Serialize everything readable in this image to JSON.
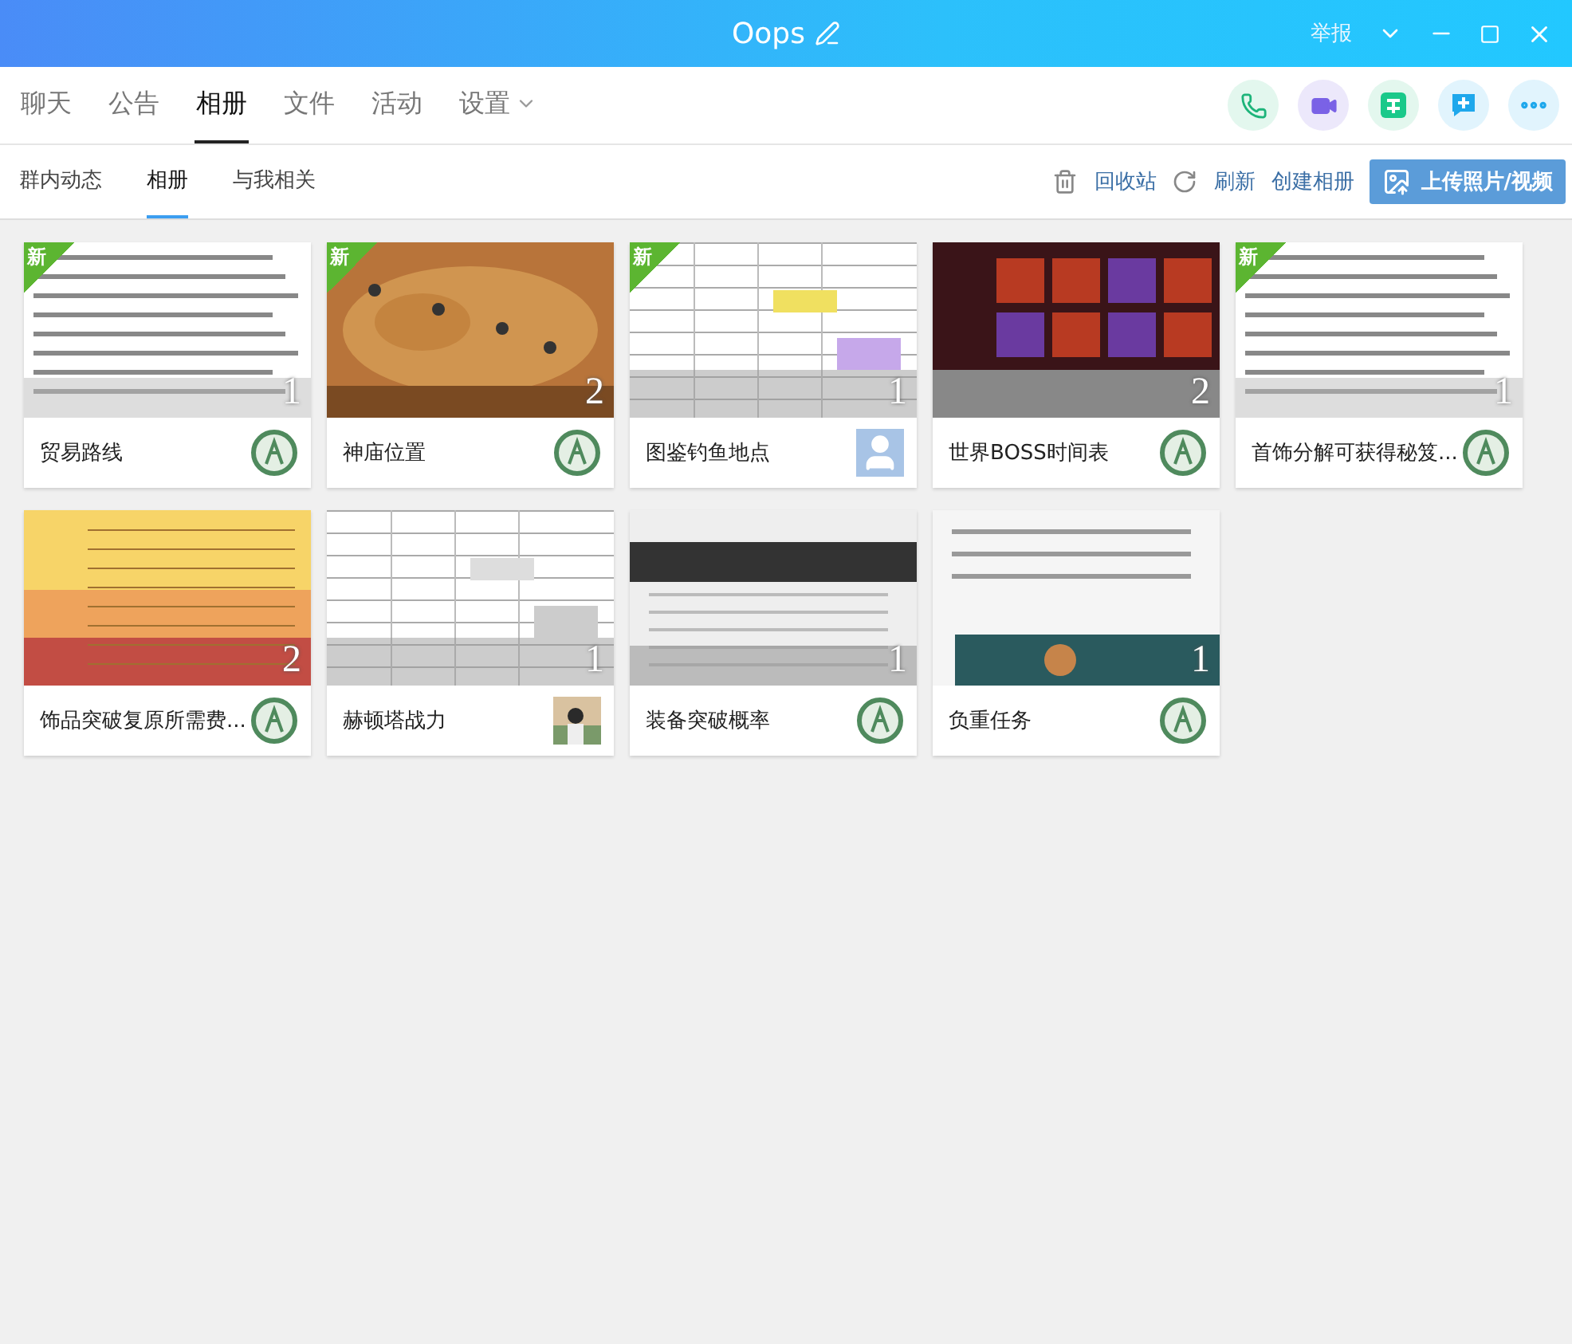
{
  "window": {
    "title": "Oops",
    "report": "举报"
  },
  "tabs": [
    {
      "label": "聊天",
      "selected": false
    },
    {
      "label": "公告",
      "selected": false
    },
    {
      "label": "相册",
      "selected": true
    },
    {
      "label": "文件",
      "selected": false
    },
    {
      "label": "活动",
      "selected": false
    },
    {
      "label": "设置",
      "selected": false,
      "dropdown": true
    }
  ],
  "subtabs": [
    {
      "label": "群内动态",
      "selected": false
    },
    {
      "label": "相册",
      "selected": true
    },
    {
      "label": "与我相关",
      "selected": false
    }
  ],
  "actions": {
    "recycle": "回收站",
    "refresh": "刷新",
    "create": "创建相册",
    "upload": "上传照片/视频"
  },
  "albums": [
    {
      "title": "贸易路线",
      "count": "1",
      "badge": "新",
      "avatar": {
        "kind": "emblem"
      }
    },
    {
      "title": "神庙位置",
      "count": "2",
      "badge": "新",
      "avatar": {
        "kind": "emblem"
      }
    },
    {
      "title": "图鉴钓鱼地点",
      "count": "1",
      "badge": "新",
      "avatar": {
        "kind": "default"
      }
    },
    {
      "title": "世界BOSS时间表",
      "count": "2",
      "avatar": {
        "kind": "emblem"
      }
    },
    {
      "title": "首饰分解可获得秘笈...",
      "count": "1",
      "badge": "新",
      "avatar": {
        "kind": "emblem"
      }
    },
    {
      "title": "饰品突破复原所需费...",
      "count": "2",
      "avatar": {
        "kind": "emblem"
      }
    },
    {
      "title": "赫顿塔战力",
      "count": "1"
    },
    {
      "title": "装备突破概率",
      "count": "1",
      "avatar": {
        "kind": "emblem"
      }
    },
    {
      "title": "负重任务",
      "count": "1",
      "avatar": {
        "kind": "emblem"
      }
    }
  ]
}
